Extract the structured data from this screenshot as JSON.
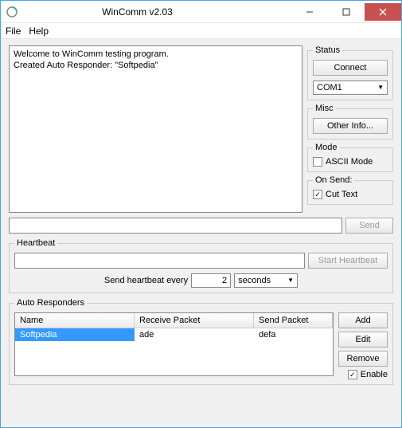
{
  "window": {
    "title": "WinComm v2.03"
  },
  "menu": {
    "file": "File",
    "help": "Help"
  },
  "log": {
    "line1": "Welcome to WinComm testing program.",
    "line2": "Created Auto Responder:  \"Softpedia\""
  },
  "status": {
    "legend": "Status",
    "connect_button": "Connect",
    "port": "COM1"
  },
  "misc": {
    "legend": "Misc",
    "other_info_button": "Other Info..."
  },
  "mode": {
    "legend": "Mode",
    "ascii_label": "ASCII Mode",
    "ascii_checked": false
  },
  "on_send": {
    "legend": "On Send:",
    "cut_text_label": "Cut Text",
    "cut_text_checked": true
  },
  "send": {
    "input_value": "",
    "button": "Send"
  },
  "heartbeat": {
    "legend": "Heartbeat",
    "input_value": "",
    "start_button": "Start Heartbeat",
    "label": "Send heartbeat every",
    "interval": "2",
    "unit": "seconds"
  },
  "auto_responders": {
    "legend": "Auto Responders",
    "columns": {
      "name": "Name",
      "receive": "Receive Packet",
      "send": "Send Packet"
    },
    "rows": [
      {
        "name": "Softpedia",
        "receive": "ade",
        "send": "defa"
      }
    ],
    "buttons": {
      "add": "Add",
      "edit": "Edit",
      "remove": "Remove"
    },
    "enable_label": "Enable",
    "enable_checked": true
  }
}
